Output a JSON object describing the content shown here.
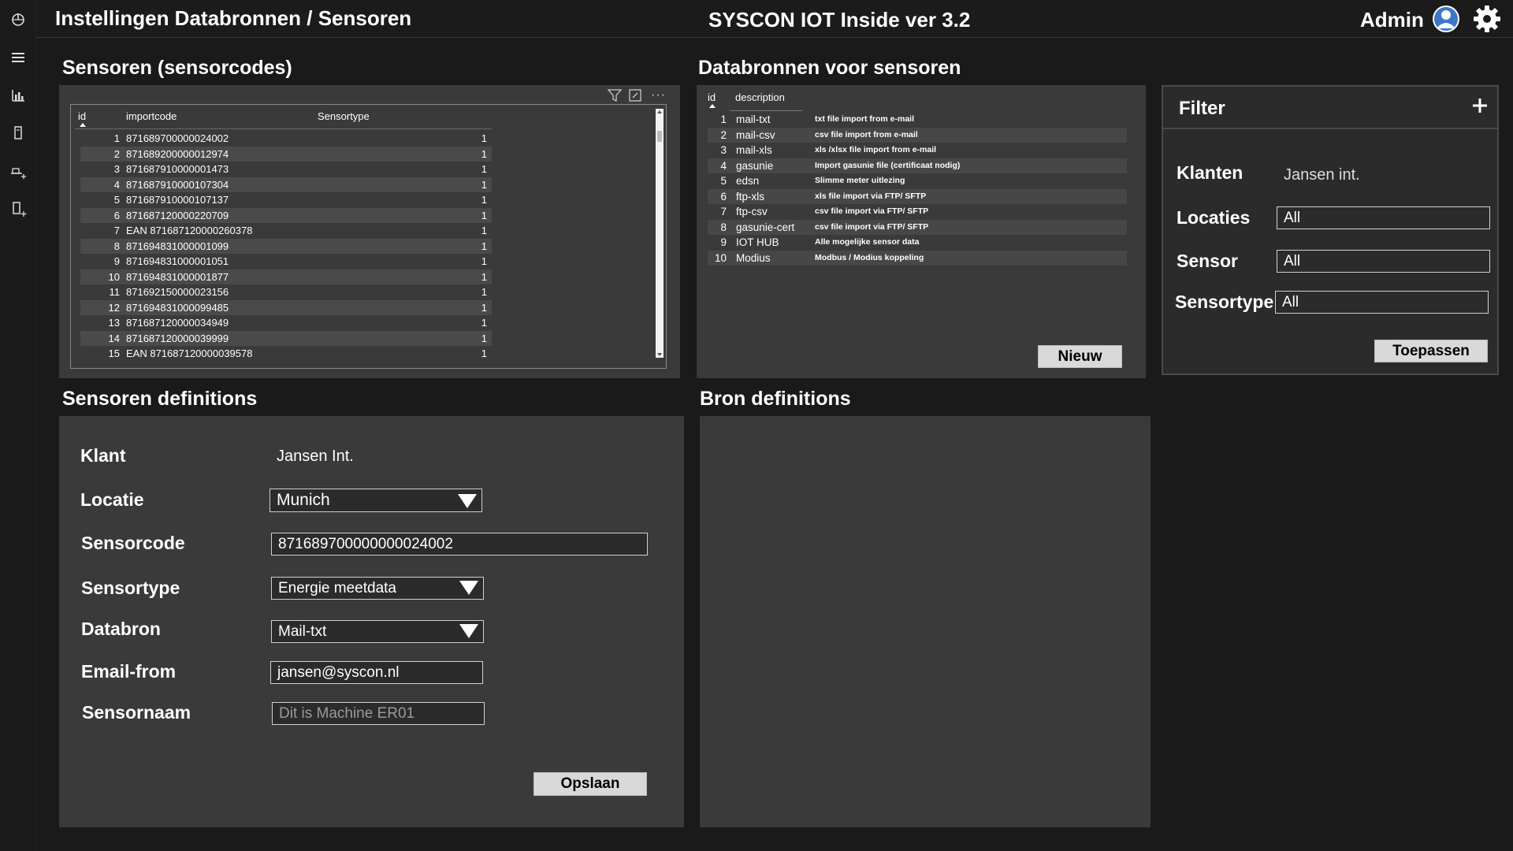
{
  "header": {
    "page_title": "Instellingen Databronnen / Sensoren",
    "app_title": "SYSCON IOT Inside ver 3.2",
    "user": "Admin"
  },
  "sidebar": {
    "items": [
      "power-icon",
      "menu-icon",
      "chart-icon",
      "device-icon",
      "sensor-add-icon",
      "device-add-icon"
    ]
  },
  "sensors": {
    "title": "Sensoren (sensorcodes)",
    "columns": [
      "id",
      "importcode",
      "Sensortype"
    ],
    "rows": [
      {
        "id": "1",
        "code": "871689700000024002",
        "type": "1"
      },
      {
        "id": "2",
        "code": "871689200000012974",
        "type": "1"
      },
      {
        "id": "3",
        "code": "871687910000001473",
        "type": "1"
      },
      {
        "id": "4",
        "code": "871687910000107304",
        "type": "1"
      },
      {
        "id": "5",
        "code": "871687910000107137",
        "type": "1"
      },
      {
        "id": "6",
        "code": "871687120000220709",
        "type": "1"
      },
      {
        "id": "7",
        "code": "EAN 871687120000260378",
        "type": "1"
      },
      {
        "id": "8",
        "code": "871694831000001099",
        "type": "1"
      },
      {
        "id": "9",
        "code": "871694831000001051",
        "type": "1"
      },
      {
        "id": "10",
        "code": "871694831000001877",
        "type": "1"
      },
      {
        "id": "11",
        "code": "871692150000023156",
        "type": "1"
      },
      {
        "id": "12",
        "code": "871694831000099485",
        "type": "1"
      },
      {
        "id": "13",
        "code": "871687120000034949",
        "type": "1"
      },
      {
        "id": "14",
        "code": "871687120000039999",
        "type": "1"
      },
      {
        "id": "15",
        "code": "EAN 871687120000039578",
        "type": "1"
      }
    ]
  },
  "databronnen": {
    "title": "Databronnen voor sensoren",
    "columns": [
      "id",
      "description"
    ],
    "rows": [
      {
        "id": "1",
        "name": "mail-txt",
        "desc": "txt file import from e-mail"
      },
      {
        "id": "2",
        "name": "mail-csv",
        "desc": "csv file import from e-mail"
      },
      {
        "id": "3",
        "name": "mail-xls",
        "desc": "xls /xlsx file import from e-mail"
      },
      {
        "id": "4",
        "name": "gasunie",
        "desc": "Import gasunie file (certificaat nodig)"
      },
      {
        "id": "5",
        "name": "edsn",
        "desc": "Slimme meter uitlezing"
      },
      {
        "id": "6",
        "name": "ftp-xls",
        "desc": "xls file import via FTP/ SFTP"
      },
      {
        "id": "7",
        "name": "ftp-csv",
        "desc": "csv file import via FTP/ SFTP"
      },
      {
        "id": "8",
        "name": "gasunie-cert",
        "desc": "csv file import via FTP/ SFTP"
      },
      {
        "id": "9",
        "name": "IOT HUB",
        "desc": "Alle mogelijke sensor data"
      },
      {
        "id": "10",
        "name": "Modius",
        "desc": "Modbus / Modius koppeling"
      }
    ],
    "new_button": "Nieuw"
  },
  "filter": {
    "title": "Filter",
    "klanten_label": "Klanten",
    "klanten_value": "Jansen int.",
    "locaties_label": "Locaties",
    "locaties_value": "All",
    "sensor_label": "Sensor",
    "sensor_value": "All",
    "sensortype_label": "Sensortype",
    "sensortype_value": "All",
    "apply_button": "Toepassen"
  },
  "definitions": {
    "title": "Sensoren definitions",
    "klant_label": "Klant",
    "klant_value": "Jansen Int.",
    "locatie_label": "Locatie",
    "locatie_value": "Munich",
    "sensorcode_label": "Sensorcode",
    "sensorcode_value": "871689700000000024002",
    "sensortype_label": "Sensortype",
    "sensortype_value": "Energie meetdata",
    "databron_label": "Databron",
    "databron_value": "Mail-txt",
    "email_label": "Email-from",
    "email_value": "jansen@syscon.nl",
    "sensornaam_label": "Sensornaam",
    "sensornaam_placeholder": "Dit is Machine ER01",
    "save_button": "Opslaan"
  },
  "bron": {
    "title": "Bron definitions"
  }
}
